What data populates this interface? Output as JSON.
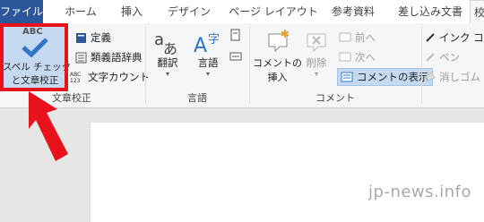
{
  "tabs": [
    "ファイル",
    "ホーム",
    "挿入",
    "デザイン",
    "ページ レイアウト",
    "参考資料",
    "差し込み文書",
    "校"
  ],
  "groups": {
    "proofing": {
      "label": "文章校正",
      "spell": {
        "abc": "ABC",
        "line1": "スペル チェック",
        "line2": "と文章校正"
      },
      "items": [
        "定義",
        "類義語辞典",
        "文字カウント"
      ]
    },
    "language": {
      "label": "言語",
      "translate": "翻訳",
      "language": "言語"
    },
    "comments": {
      "label": "コメント",
      "new_comment_line1": "コメントの",
      "new_comment_line2": "挿入",
      "delete": "削除",
      "prev": "前へ",
      "next": "次へ",
      "show": "コメントの表示"
    },
    "ink": {
      "items": [
        "インク コメ",
        "ペン",
        "消しゴム"
      ]
    }
  },
  "watermark": "jp-news.info",
  "colors": {
    "file_tab": "#2b579a",
    "highlight": "#e8121c",
    "arrow": "#e8121c",
    "check": "#2f75c7"
  }
}
